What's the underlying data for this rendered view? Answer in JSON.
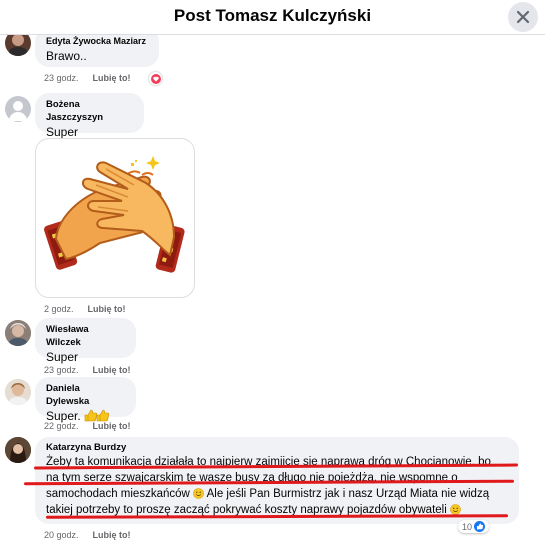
{
  "header": {
    "title": "Post Tomasz Kulczyński"
  },
  "comments": [
    {
      "author": "Edyta Żywocka Maziarz",
      "text": "Brawo..",
      "time": "23 godz.",
      "like": "Lubię to!",
      "reaction": "heart-icon"
    },
    {
      "author": "Bożena Jaszczyszyn",
      "text": "Super",
      "time": "2 godz.",
      "like": "Lubię to!",
      "sticker": "clapping-hands-sticker"
    },
    {
      "author": "Wiesława Wilczek",
      "text": "Super",
      "time": "23 godz.",
      "like": "Lubię to!"
    },
    {
      "author": "Daniela Dylewska",
      "text": "Super.",
      "time": "22 godz.",
      "like": "Lubię to!"
    },
    {
      "author": "Katarzyna Burdzy",
      "lines": [
        "Żeby ta komunikacja działała to najpierw zajmijcie się naprawa dróg w Chocianowie, bo",
        "na tym serze szwajcarskim te wasze busy za długo nie pojeżdżą, nie wspomne o",
        "samochodach mieszkańców",
        "Ale jeśli Pan Burmistrz jak i nasz Urząd Miata nie widzą",
        "takiej potrzeby to proszę zacząć pokrywać koszty naprawy pojazdów obywateli"
      ],
      "reaction_count": "10",
      "time": "20 godz.",
      "like": "Lubię to!"
    }
  ],
  "colors": {
    "bubble": "#f0f2f5",
    "underline": "#e0191c",
    "like_blue": "#1877f2",
    "heart": "#f33e58"
  }
}
